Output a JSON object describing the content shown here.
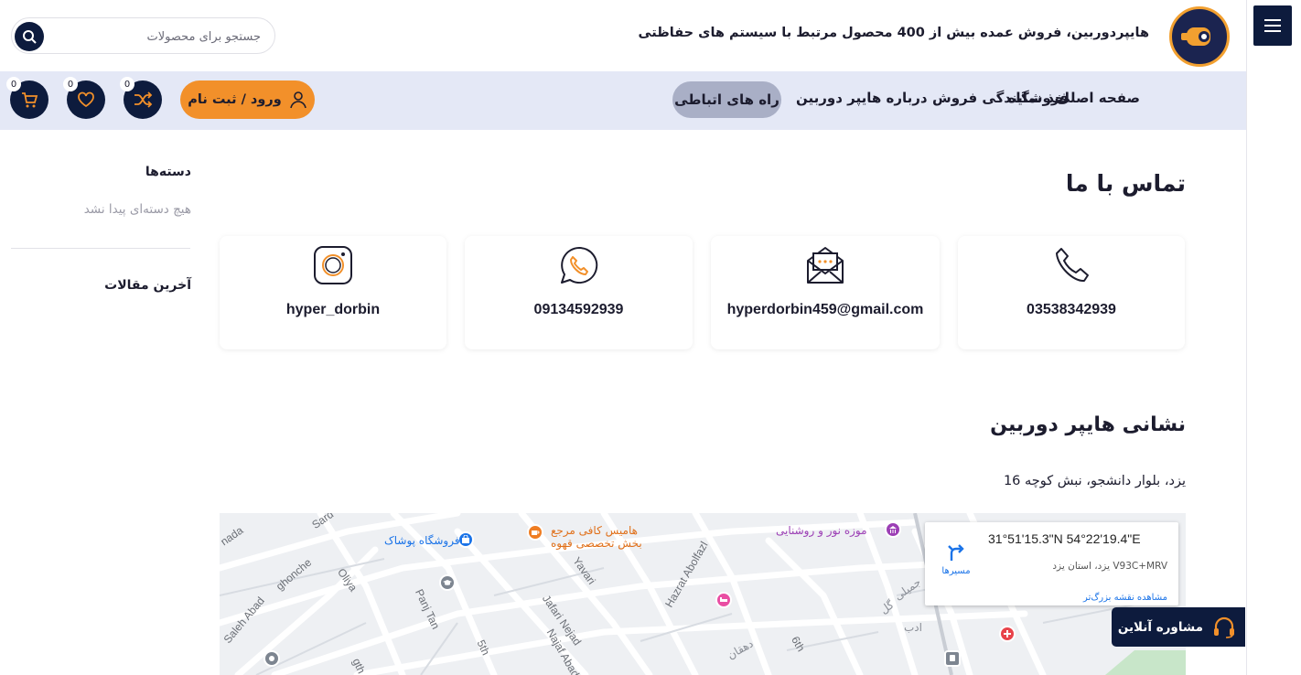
{
  "header": {
    "tagline": "هایپردوربین، فروش عمده بیش از 400 محصول مرتبط با سیستم های حفاظتی",
    "search_placeholder": "جستجو برای محصولات"
  },
  "nav": {
    "items": [
      "صفحه اصلی",
      "فروشگاه",
      "اخذ نمایندگی فروش",
      "درباره هایپر دوربین"
    ],
    "active": "راه های اتباطی",
    "login_label": "ورود / ثبت نام",
    "compare_count": "0",
    "wishlist_count": "0",
    "cart_count": "0"
  },
  "contact": {
    "title": "تماس با ما",
    "cards": [
      {
        "icon": "phone-icon",
        "value": "03538342939"
      },
      {
        "icon": "email-icon",
        "value": "hyperdorbin459@gmail.com"
      },
      {
        "icon": "whatsapp-icon",
        "value": "09134592939"
      },
      {
        "icon": "instagram-icon",
        "value": "hyper_dorbin"
      }
    ]
  },
  "address": {
    "title": "نشانی هایپر دوربین",
    "text": "یزد، بلوار دانشجو، نبش کوچه 16"
  },
  "sidebar": {
    "categories_title": "دسته‌ها",
    "categories_empty": "هیچ دسته‌ای پیدا نشد",
    "latest_title": "آخرین مقالات"
  },
  "map": {
    "coords": "31°51'15.3\"N 54°22'19.4\"E",
    "plus_code": "V93C+MRV یزد، استان یزد",
    "big_map_link": "مشاهده نقشه بزرگ‌تر",
    "directions_label": "مسیرها",
    "labels": [
      "Saleh Abad",
      "ghonche",
      "Oliya",
      "Panj Tan",
      "Jafari Nejad",
      "Najaf Abad",
      "Yavari",
      "Hazrat Abolfazl",
      "5th",
      "6th",
      "Sard",
      "nada",
      "gth",
      "ادب",
      "گل",
      "جمیلی",
      "دهقان"
    ],
    "places": [
      "فروشگاه پوشاک",
      "هامیس کافی مرجع",
      "بخش تخصصی قهوه",
      "موزه نور و روشنایی"
    ]
  },
  "consult": {
    "label": "مشاوره آنلاین"
  },
  "colors": {
    "navy": "#0d1b3d",
    "orange": "#f2902a",
    "nav_bg": "#e4e8f6",
    "active_pill": "#a9afc6"
  }
}
